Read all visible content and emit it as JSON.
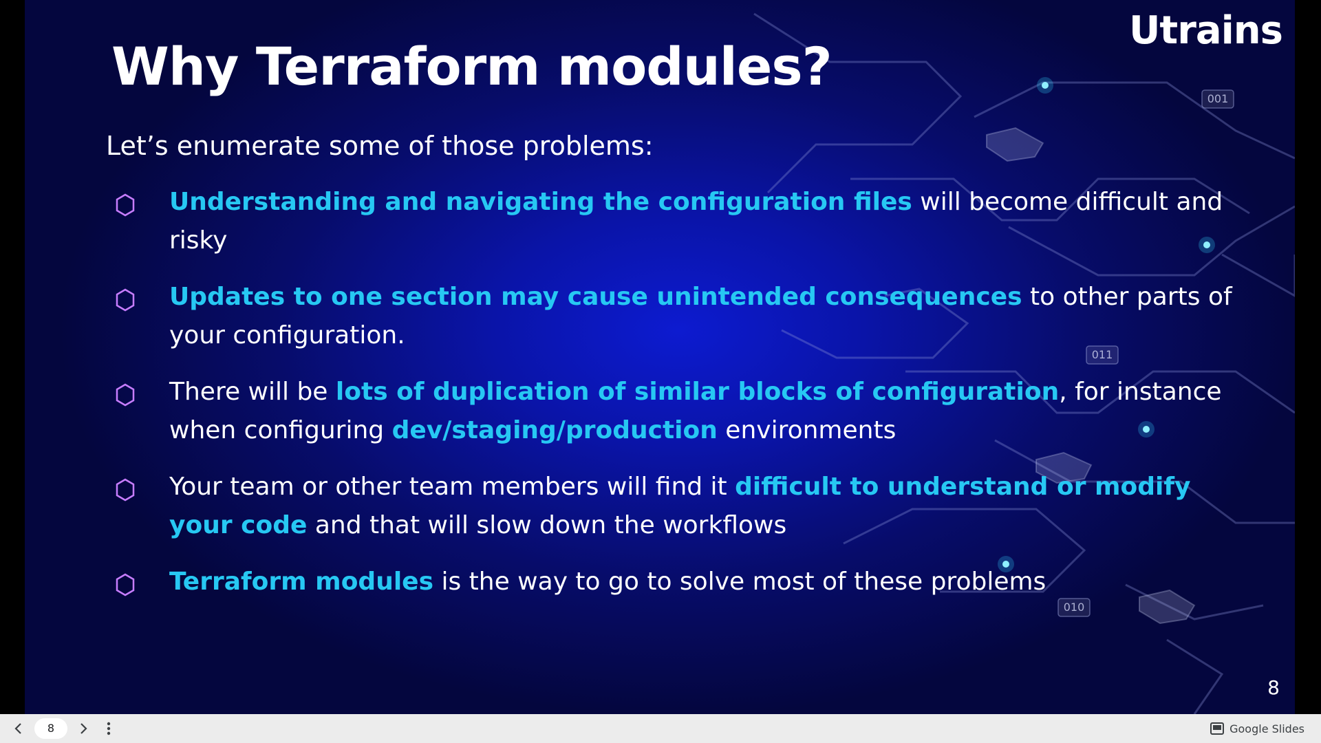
{
  "slide": {
    "logo": "Utrains",
    "title": "Why Terraform modules?",
    "subtitle": "Let’s enumerate some of those problems:",
    "bullets": [
      {
        "parts": [
          {
            "text": "Understanding and navigating the configuration files",
            "highlight": true
          },
          {
            "text": " will become difficult and risky",
            "highlight": false
          }
        ]
      },
      {
        "parts": [
          {
            "text": "Updates to one section may cause unintended consequences",
            "highlight": true
          },
          {
            "text": " to other parts of your configuration.",
            "highlight": false
          }
        ]
      },
      {
        "parts": [
          {
            "text": "There will be ",
            "highlight": false
          },
          {
            "text": "lots of duplication of similar blocks of configuration",
            "highlight": true
          },
          {
            "text": ", for instance when configuring ",
            "highlight": false
          },
          {
            "text": "dev/staging/production",
            "highlight": true
          },
          {
            "text": " environments",
            "highlight": false
          }
        ]
      },
      {
        "parts": [
          {
            "text": "Your team or other team members will find it ",
            "highlight": false
          },
          {
            "text": "difficult to understand or modify your code",
            "highlight": true
          },
          {
            "text": " and that will slow down the workflows",
            "highlight": false
          }
        ]
      },
      {
        "parts": [
          {
            "text": "Terraform modules",
            "highlight": true
          },
          {
            "text": " is the way to go to solve most of these problems",
            "highlight": false
          }
        ]
      }
    ],
    "slide_number": "8",
    "decor_labels": [
      "001",
      "011",
      "010"
    ],
    "colors": {
      "highlight": "#27c8f3",
      "bullet_icon": "#c77dff",
      "background": "#070c6a"
    }
  },
  "player": {
    "prev_icon": "chevron-left-icon",
    "page_input": "8",
    "next_icon": "chevron-right-icon",
    "menu_icon": "more-vert-icon",
    "brand_icon": "slides-icon",
    "brand": "Google Slides"
  }
}
